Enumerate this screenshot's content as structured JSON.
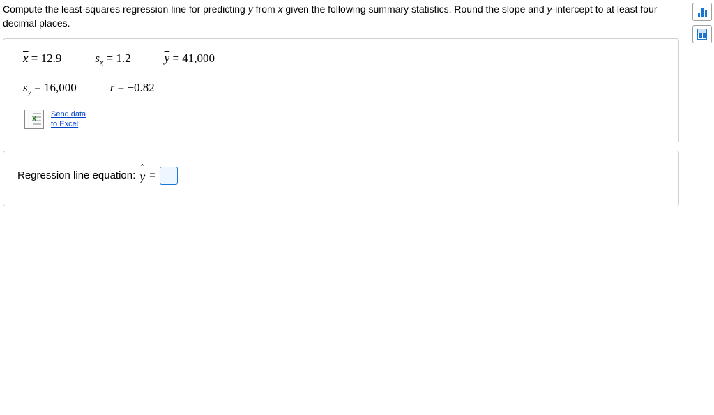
{
  "question": {
    "text_pre": "Compute the least-squares regression line for predicting ",
    "y_var": "y",
    "text_mid": " from ",
    "x_var": "x",
    "text_post": " given the following summary statistics. Round the slope and ",
    "y_intercept_var": "y",
    "text_end": "-intercept to at least four decimal places."
  },
  "stats": {
    "x_mean_label": "x",
    "x_mean_eq": " = 12.9",
    "sx_label": "s",
    "sx_sub": "x",
    "sx_eq": " = 1.2",
    "y_mean_label": "y",
    "y_mean_eq": " = 41,000",
    "sy_label": "s",
    "sy_sub": "y",
    "sy_eq": " = 16,000",
    "r_label": "r",
    "r_eq": " = −0.82"
  },
  "send_link": {
    "line1": "Send data",
    "line2": "to Excel"
  },
  "answer": {
    "label": "Regression line equation: ",
    "yhat": "y",
    "equals": " = "
  },
  "tools": {
    "chart": "bar-chart",
    "calc": "calculator"
  }
}
